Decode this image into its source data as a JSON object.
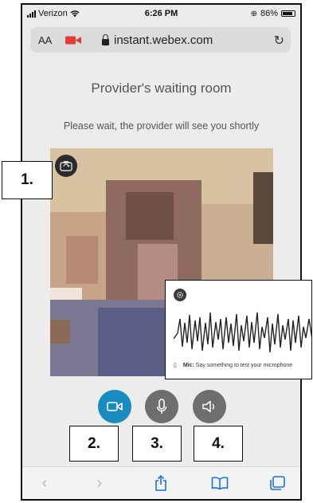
{
  "status_bar": {
    "carrier": "Verizon",
    "time": "6:26 PM",
    "battery": "86%"
  },
  "browser": {
    "text_size_label": "AA",
    "url": "instant.webex.com"
  },
  "page": {
    "title": "Provider's waiting room",
    "subtitle": "Please wait, the provider will see you shortly"
  },
  "mic_test": {
    "label": "Mic:",
    "prompt": "Say something to test your microphone"
  },
  "callouts": [
    "1.",
    "2.",
    "3.",
    "4."
  ],
  "colors": {
    "video_button": "#1a8bbf",
    "control_button": "#6e6e6e",
    "recording_icon": "#e53935",
    "toolbar_icon": "#1a73e8"
  },
  "icons": [
    "camera-flip-icon",
    "video-camera-icon",
    "microphone-icon",
    "speaker-icon",
    "back-icon",
    "forward-icon",
    "share-icon",
    "bookmarks-icon",
    "tabs-icon",
    "settings-icon"
  ]
}
